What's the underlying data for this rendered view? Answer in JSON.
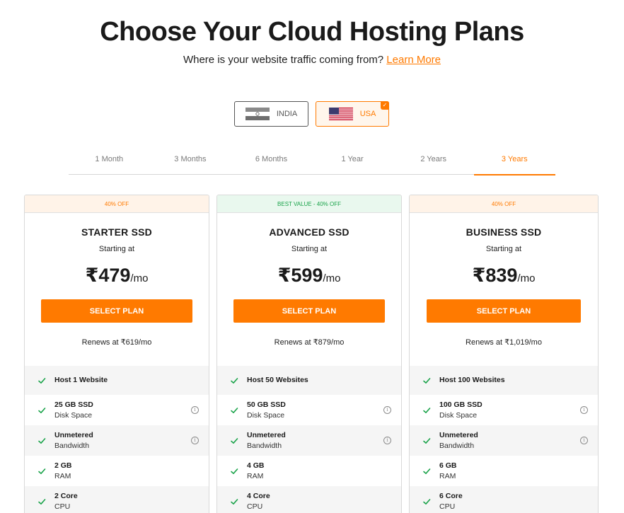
{
  "header": {
    "title": "Choose Your Cloud Hosting Plans",
    "subtitle": "Where is your website traffic coming from?",
    "learn_more": "Learn More"
  },
  "regions": [
    {
      "label": "INDIA",
      "flag": "india-flag-icon",
      "selected": false
    },
    {
      "label": "USA",
      "flag": "usa-flag-icon",
      "selected": true
    }
  ],
  "durations": [
    "1 Month",
    "3 Months",
    "6 Months",
    "1 Year",
    "2 Years",
    "3 Years"
  ],
  "selected_duration": "3 Years",
  "colors": {
    "accent": "#ff7a00",
    "best_value": "#1aa34a",
    "check": "#1aa34a"
  },
  "plans": [
    {
      "badge": "40% OFF",
      "name": "STARTER SSD",
      "starting": "Starting at",
      "price": "₹479",
      "per": "/mo",
      "cta": "SELECT PLAN",
      "renews": "Renews at ₹619/mo",
      "features": [
        {
          "line1": "Host 1 Website"
        },
        {
          "line1": "25 GB SSD",
          "line2": "Disk Space",
          "info": true
        },
        {
          "line1": "Unmetered",
          "line2": "Bandwidth",
          "info": true
        },
        {
          "line1": "2 GB",
          "line2": "RAM"
        },
        {
          "line1": "2 Core",
          "line2": "CPU"
        }
      ]
    },
    {
      "badge": "BEST VALUE - 40% OFF",
      "name": "ADVANCED SSD",
      "starting": "Starting at",
      "price": "₹599",
      "per": "/mo",
      "cta": "SELECT PLAN",
      "renews": "Renews at ₹879/mo",
      "features": [
        {
          "line1": "Host 50 Websites"
        },
        {
          "line1": "50 GB SSD",
          "line2": "Disk Space",
          "info": true
        },
        {
          "line1": "Unmetered",
          "line2": "Bandwidth",
          "info": true
        },
        {
          "line1": "4 GB",
          "line2": "RAM"
        },
        {
          "line1": "4 Core",
          "line2": "CPU"
        }
      ]
    },
    {
      "badge": "40% OFF",
      "name": "BUSINESS SSD",
      "starting": "Starting at",
      "price": "₹839",
      "per": "/mo",
      "cta": "SELECT PLAN",
      "renews": "Renews at ₹1,019/mo",
      "features": [
        {
          "line1": "Host 100 Websites"
        },
        {
          "line1": "100 GB SSD",
          "line2": "Disk Space",
          "info": true
        },
        {
          "line1": "Unmetered",
          "line2": "Bandwidth",
          "info": true
        },
        {
          "line1": "6 GB",
          "line2": "RAM"
        },
        {
          "line1": "6 Core",
          "line2": "CPU"
        }
      ]
    }
  ]
}
